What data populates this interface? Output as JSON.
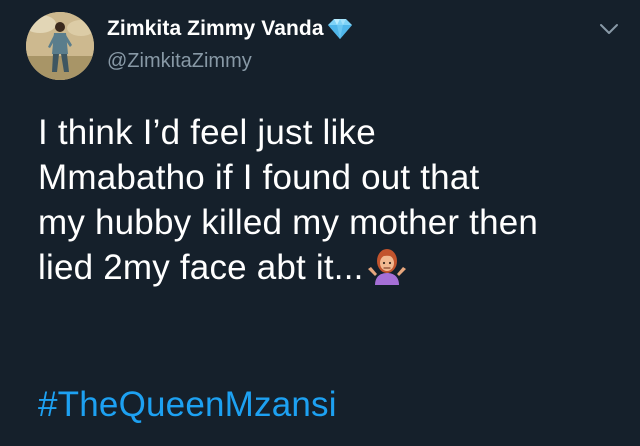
{
  "tweet": {
    "author": {
      "display_name": "Zimkita Zimmy Vanda",
      "badge_icon": "diamond-icon",
      "handle": "@ZimkitaZimmy"
    },
    "menu_icon": "chevron-down-icon",
    "text_lines": [
      "I think I’d feel just like",
      "Mmabatho if I found out that",
      "my hubby killed my mother then",
      "lied 2my face abt it..."
    ],
    "trailing_emoji": "person-shrugging-emoji",
    "hashtag": "#TheQueenMzansi"
  },
  "colors": {
    "background": "#15202b",
    "text": "#ffffff",
    "secondary_text": "#8899a6",
    "link": "#1da1f2",
    "badge": "#7fd3f7"
  }
}
